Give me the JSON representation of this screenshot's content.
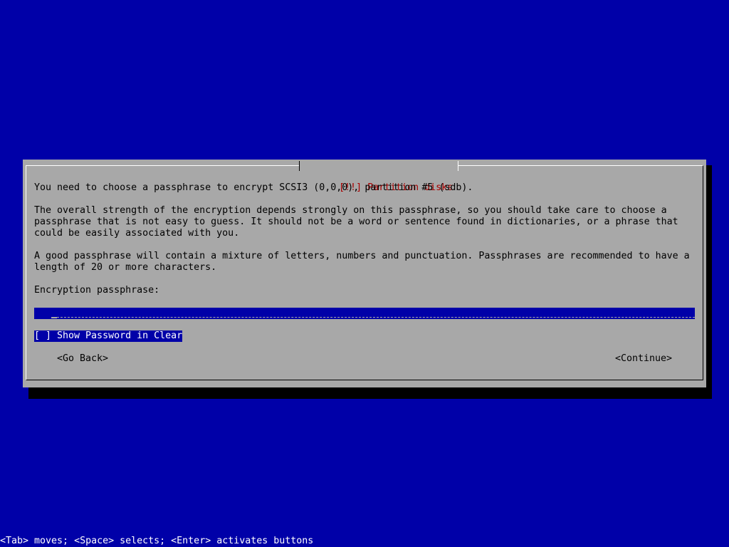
{
  "dialog": {
    "title": "[!!] Partition disks",
    "intro": "You need to choose a passphrase to encrypt SCSI3 (0,0,0), partition #5 (sdb).",
    "strength_lines": [
      "The overall strength of the encryption depends strongly on this passphrase, so you should take care to choose a",
      "passphrase that is not easy to guess. It should not be a word or sentence found in dictionaries, or a phrase that",
      "could be easily associated with you."
    ],
    "advice_lines": [
      "A good passphrase will contain a mixture of letters, numbers and punctuation. Passphrases are recommended to have a",
      "length of 20 or more characters."
    ],
    "field_label": "Encryption passphrase:",
    "field_value": "***",
    "show_password_checkbox": "[ ] Show Password in Clear",
    "back_button": "<Go Back>",
    "continue_button": "<Continue>"
  },
  "help_line": "<Tab> moves; <Space> selects; <Enter> activates buttons",
  "colors": {
    "background": "#0000a8",
    "dialog": "#a8a8a8",
    "title": "#a80000",
    "highlight": "#0000a8"
  }
}
